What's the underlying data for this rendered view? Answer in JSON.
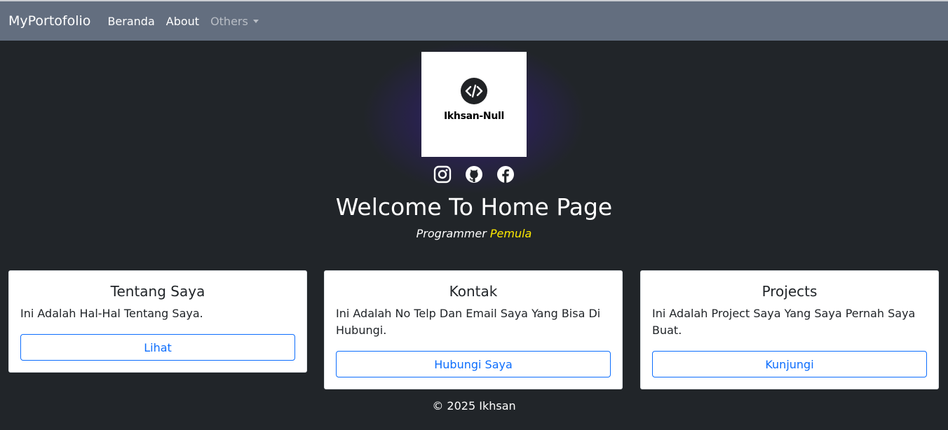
{
  "navbar": {
    "brand": "MyPortofolio",
    "links": [
      {
        "label": "Beranda"
      },
      {
        "label": "About"
      },
      {
        "label": "Others"
      }
    ]
  },
  "hero": {
    "logo_text": "Ikhsan-Null",
    "logo_icon": "code-icon",
    "socials": [
      {
        "icon": "instagram-icon"
      },
      {
        "icon": "github-icon"
      },
      {
        "icon": "facebook-icon"
      }
    ],
    "title": "Welcome To Home Page",
    "subtitle_prefix": "Programmer",
    "subtitle_highlight": "Pemula",
    "highlight_color": "#ffea00"
  },
  "cards": [
    {
      "title": "Tentang Saya",
      "text": "Ini Adalah Hal-Hal Tentang Saya.",
      "button": "Lihat"
    },
    {
      "title": "Kontak",
      "text": "Ini Adalah No Telp Dan Email Saya Yang Bisa Di Hubungi.",
      "button": "Hubungi Saya"
    },
    {
      "title": "Projects",
      "text": "Ini Adalah Project Saya Yang Saya Pernah Saya Buat.",
      "button": "Kunjungi"
    }
  ],
  "footer": {
    "text": "© 2025 Ikhsan"
  },
  "colors": {
    "navbar_bg": "#636e7f",
    "page_bg": "#212529",
    "primary": "#0d6efd"
  }
}
